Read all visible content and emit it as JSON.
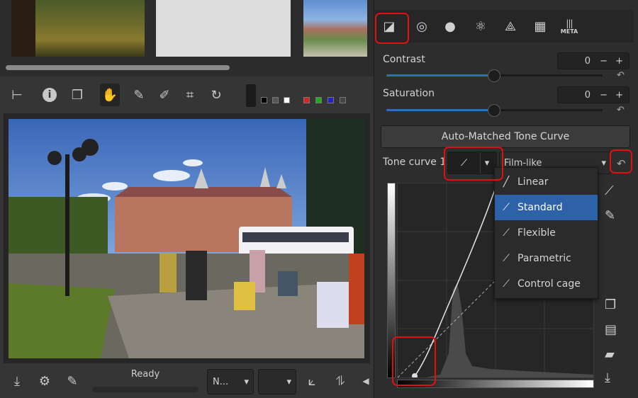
{
  "status": {
    "text": "Ready"
  },
  "bottom": {
    "profile_combo": "N...",
    "combo_arrow": "▾"
  },
  "tool_panel": {
    "tabs": [
      {
        "name": "exposure-tab",
        "glyph": "◪"
      },
      {
        "name": "detail-tab",
        "glyph": "◎"
      },
      {
        "name": "color-tab",
        "glyph": "●"
      },
      {
        "name": "advanced-tab",
        "glyph": "⚛"
      },
      {
        "name": "transform-tab",
        "glyph": "⟁"
      },
      {
        "name": "raw-tab",
        "glyph": "▦"
      },
      {
        "name": "metadata-tab",
        "glyph": "|||",
        "label": "META"
      }
    ],
    "contrast": {
      "label": "Contrast",
      "value": "0",
      "fraction": 0.5
    },
    "saturation": {
      "label": "Saturation",
      "value": "0",
      "fraction": 0.5
    },
    "auto_matched_button": "Auto-Matched Tone Curve",
    "tone_curve": {
      "label": "Tone curve 1:",
      "mode_selected": "Film-like",
      "type_items": [
        {
          "label": "Linear",
          "icon": "linear-icon"
        },
        {
          "label": "Standard",
          "icon": "standard-icon",
          "selected": true
        },
        {
          "label": "Flexible",
          "icon": "flexible-icon"
        },
        {
          "label": "Parametric",
          "icon": "parametric-icon"
        },
        {
          "label": "Control cage",
          "icon": "control-cage-icon"
        }
      ]
    },
    "plus": "+",
    "minus": "−"
  },
  "colors": {
    "accent": "#2e62a8",
    "highlight_box": "#e01010",
    "slider": "#2f6fb8"
  }
}
